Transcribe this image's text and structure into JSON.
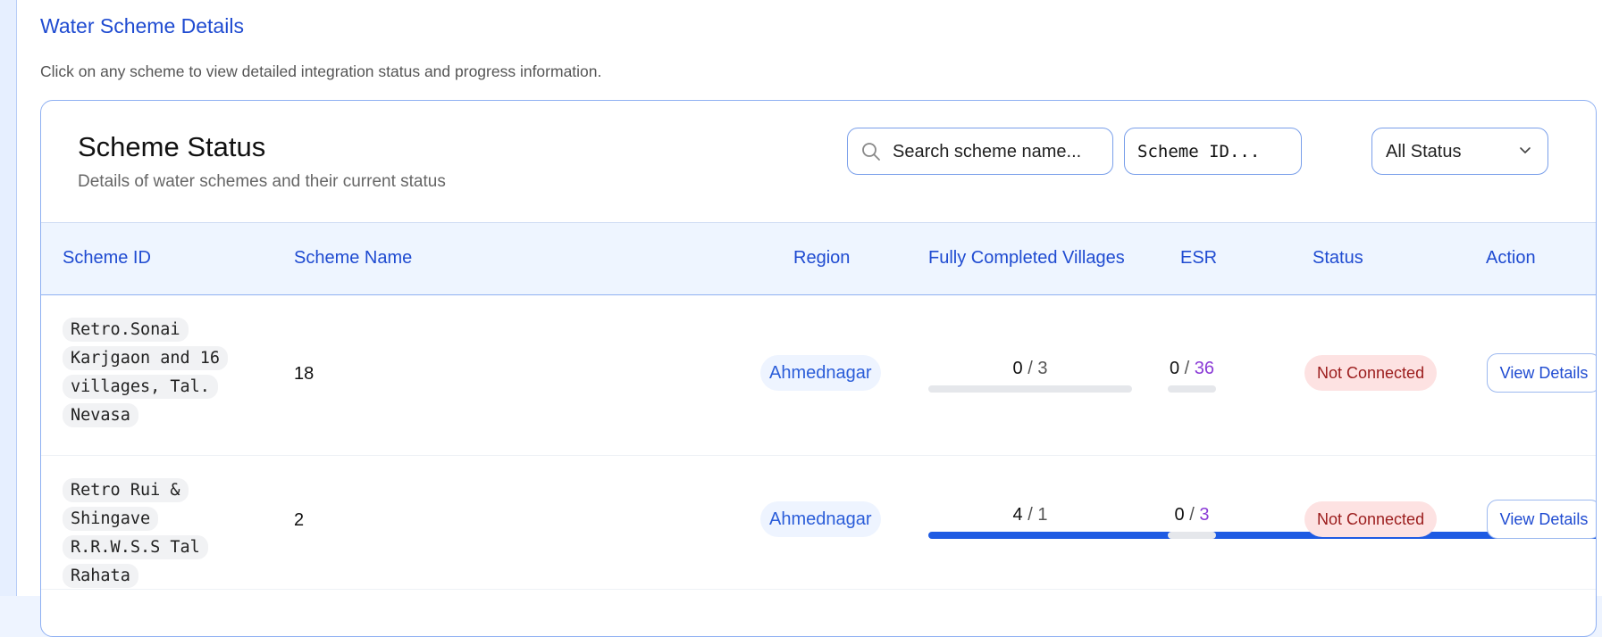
{
  "page": {
    "title": "Water Scheme Details",
    "subtitle": "Click on any scheme to view detailed integration status and progress information."
  },
  "card": {
    "title": "Scheme Status",
    "subtitle": "Details of water schemes and their current status"
  },
  "filters": {
    "search_placeholder": "Search scheme name...",
    "scheme_id_placeholder": "Scheme ID...",
    "status_selected": "All Status"
  },
  "table": {
    "columns": [
      "Scheme ID",
      "Scheme Name",
      "Region",
      "Fully Completed Villages",
      "ESR",
      "Status",
      "Action"
    ],
    "rows": [
      {
        "scheme_id": "Retro.Sonai Karjgaon and 16 villages, Tal. Nevasa",
        "scheme_name": "18",
        "region": "Ahmednagar",
        "villages_completed": "0",
        "villages_total": "3",
        "villages_fraction": 0.0,
        "esr_completed": "0",
        "esr_total": "36",
        "esr_fraction": 0.0,
        "status": "Not Connected",
        "action": "View Details"
      },
      {
        "scheme_id": "Retro Rui & Shingave R.R.W.S.S Tal Rahata",
        "scheme_name": "2",
        "region": "Ahmednagar",
        "villages_completed": "4",
        "villages_total": "1",
        "villages_fraction": 4.0,
        "esr_completed": "0",
        "esr_total": "3",
        "esr_fraction": 0.0,
        "status": "Not Connected",
        "action": "View Details"
      }
    ]
  },
  "colors": {
    "accent": "#1f4bd1",
    "bar_fill": "#1e5be3",
    "esr_total": "#8a3ad6",
    "badge_bg": "#fde2e2",
    "badge_text": "#9b1c1c"
  },
  "icons": {
    "search": "search-icon",
    "dropdown": "chevron-down-icon"
  }
}
